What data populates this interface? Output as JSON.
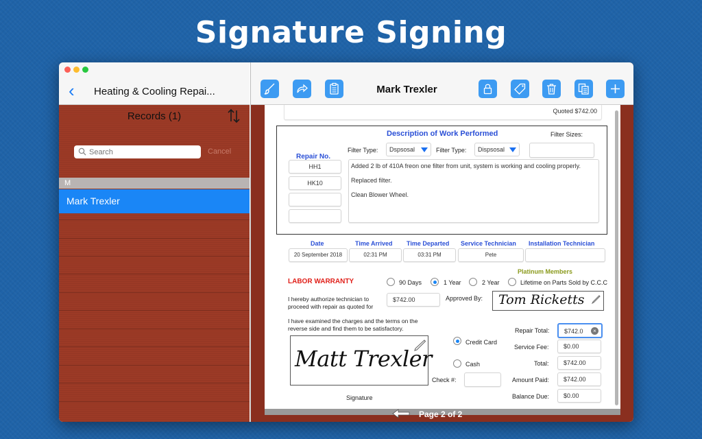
{
  "headline": "Signature Signing",
  "sidebar": {
    "title": "Heating & Cooling Repai...",
    "records_label": "Records (1)",
    "search_placeholder": "Search",
    "cancel_label": "Cancel",
    "section_letter": "M",
    "selected_record": "Mark Trexler"
  },
  "toolbar": {
    "title": "Mark Trexler",
    "icons": [
      "brush-icon",
      "share-icon",
      "clipboard-icon",
      "lock-icon",
      "tag-icon",
      "trash-icon",
      "copy-icon",
      "plus-icon"
    ]
  },
  "form": {
    "quoted": "Quoted $742.00",
    "description_title": "Description of Work Performed",
    "filter_sizes_label": "Filter Sizes:",
    "repair_no_label": "Repair No.",
    "filter_type_label": "Filter Type:",
    "filter_type_1": "Dspsosal",
    "filter_type_2": "Dispsosal",
    "repair_numbers": [
      "HH1",
      "HK10",
      "",
      ""
    ],
    "work_lines": [
      "Added 2 lb of 410A freon one filter from unit, system is working and cooling properly.",
      "Replaced filter.",
      "Clean Blower Wheel."
    ],
    "headers": {
      "date": "Date",
      "time_arrived": "Time Arrived",
      "time_departed": "Time Departed",
      "service_technician": "Service Technician",
      "installation_technician": "Installation Technician"
    },
    "values": {
      "date": "20 September 2018",
      "time_arrived": "02:31 PM",
      "time_departed": "03:31 PM",
      "service_technician": "Pete",
      "installation_technician": ""
    },
    "platinum_label": "Platinum Members",
    "labor_warranty": "LABOR WARRANTY",
    "warranty_options": [
      "90 Days",
      "1 Year",
      "2 Year",
      "Lifetime on Parts Sold by C.C.C"
    ],
    "authorize_text_1": "I hereby authorize technician to",
    "authorize_text_2": "proceed with repair as quoted for",
    "authorize_amount": "$742.00",
    "approved_by_label": "Approved By:",
    "approved_signature": "Tom Ricketts",
    "examined_text_1": "I have examined the charges and the terms on the",
    "examined_text_2": "reverse side and find them to be satisfactory.",
    "customer_signature": "Matt Trexler",
    "signature_label": "Signature",
    "payment": {
      "credit_card": "Credit Card",
      "cash": "Cash",
      "check_label": "Check #:"
    },
    "totals": {
      "repair_total_label": "Repair Total:",
      "repair_total": "$742.0",
      "service_fee_label": "Service Fee:",
      "service_fee": "$0.00",
      "total_label": "Total:",
      "total": "$742.00",
      "amount_paid_label": "Amount Paid:",
      "amount_paid": "$742.00",
      "balance_due_label": "Balance Due:",
      "balance_due": "$0.00"
    }
  },
  "pager": "Page 2 of 2",
  "colors": {
    "background": "#1f63a8",
    "accent": "#1a86f6",
    "sidebar": "#9c3a26",
    "labor_red": "#e0201a",
    "header_blue": "#2a4fd6",
    "platinum": "#8a9a1c"
  }
}
